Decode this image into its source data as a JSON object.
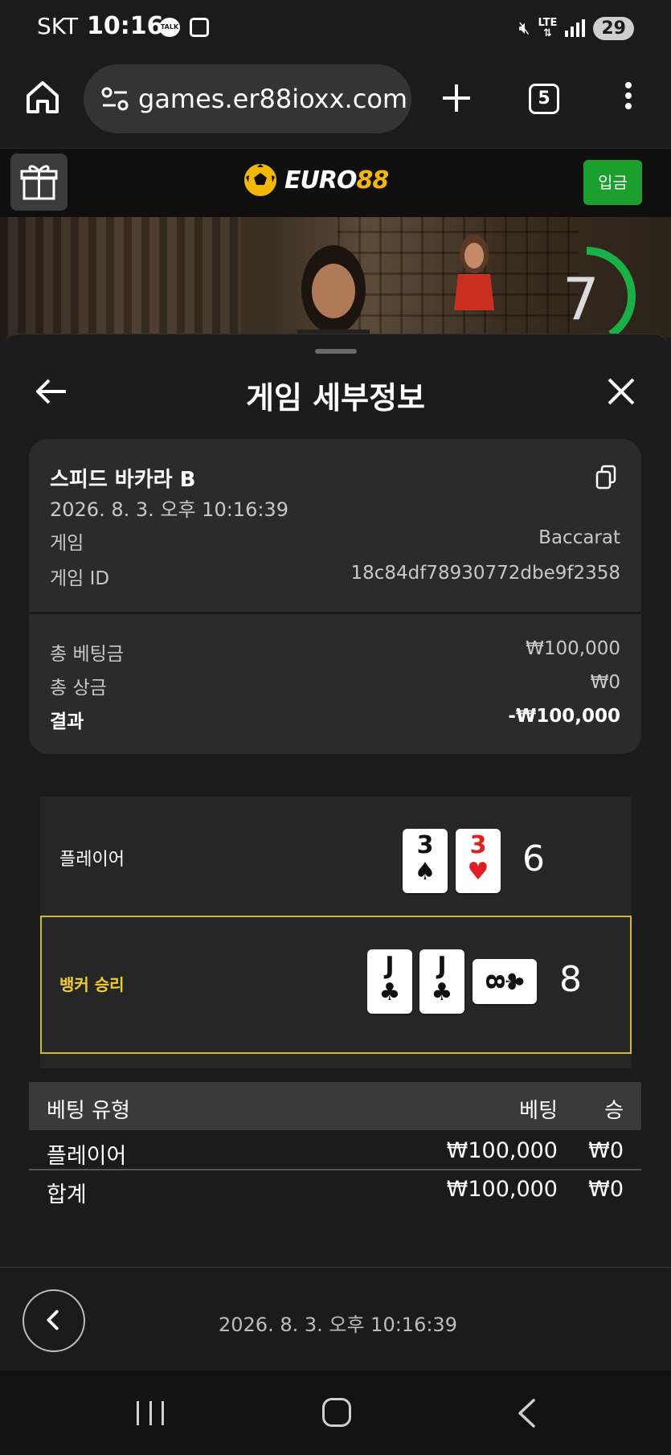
{
  "status_bar": {
    "carrier": "SKT",
    "time": "10:16",
    "talk_badge": "TALK",
    "network": "LTE",
    "battery": "29"
  },
  "browser": {
    "url": "games.er88ioxx.com",
    "tab_count": "5"
  },
  "site": {
    "logo_part1": "EURO",
    "logo_part2": "88",
    "deposit_label": "입금",
    "brand_green": "#1aa02c",
    "brand_yellow": "#f5b800"
  },
  "video": {
    "countdown": "7"
  },
  "sheet": {
    "title": "게임 세부정보",
    "game_name": "스피드 바카라 B",
    "game_datetime": "2026. 8. 3. 오후 10:16:39",
    "game_label": "게임",
    "game_value": "Baccarat",
    "game_id_label": "게임 ID",
    "game_id_value": "18c84df78930772dbe9f2358",
    "total_bet_label": "총 베팅금",
    "total_bet_value": "₩100,000",
    "total_win_label": "총 상금",
    "total_win_value": "₩0",
    "result_label": "결과",
    "result_value": "-₩100,000"
  },
  "round": {
    "player_label": "플레이어",
    "player_cards": [
      {
        "rank": "3",
        "suit": "♠",
        "color": "black"
      },
      {
        "rank": "3",
        "suit": "♥",
        "color": "red"
      }
    ],
    "player_total": "6",
    "banker_label": "뱅커 승리",
    "banker_cards": [
      {
        "rank": "J",
        "suit": "♣",
        "color": "black"
      },
      {
        "rank": "J",
        "suit": "♣",
        "color": "black"
      },
      {
        "rank": "8",
        "suit": "♣",
        "color": "black",
        "sideways": true
      }
    ],
    "banker_total": "8",
    "highlight_color": "#d4b91f"
  },
  "bets": {
    "headers": {
      "type": "베팅 유형",
      "bet": "베팅",
      "win": "승"
    },
    "rows": [
      {
        "type": "플레이어",
        "bet": "₩100,000",
        "win": "₩0"
      }
    ],
    "total": {
      "type": "합계",
      "bet": "₩100,000",
      "win": "₩0"
    }
  },
  "footer": {
    "datetime": "2026. 8. 3. 오후 10:16:39"
  }
}
